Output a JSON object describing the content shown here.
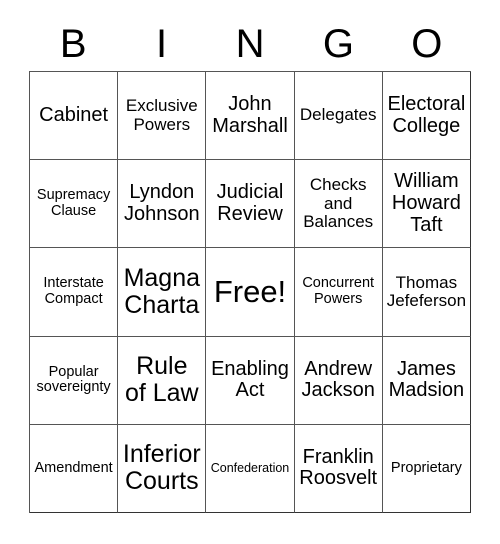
{
  "header": {
    "letters": [
      "B",
      "I",
      "N",
      "G",
      "O"
    ]
  },
  "grid": {
    "columns": 5,
    "rows": 5,
    "cells": [
      {
        "text": "Cabinet",
        "size": "l"
      },
      {
        "text": "Exclusive\nPowers",
        "size": "m"
      },
      {
        "text": "John\nMarshall",
        "size": "l"
      },
      {
        "text": "Delegates",
        "size": "m"
      },
      {
        "text": "Electoral\nCollege",
        "size": "l"
      },
      {
        "text": "Supremacy\nClause",
        "size": "s"
      },
      {
        "text": "Lyndon\nJohnson",
        "size": "l"
      },
      {
        "text": "Judicial\nReview",
        "size": "l"
      },
      {
        "text": "Checks\nand\nBalances",
        "size": "m"
      },
      {
        "text": "William\nHoward\nTaft",
        "size": "l"
      },
      {
        "text": "Interstate\nCompact",
        "size": "s"
      },
      {
        "text": "Magna\nCharta",
        "size": "xl"
      },
      {
        "text": "Free!",
        "size": "xxl"
      },
      {
        "text": "Concurrent\nPowers",
        "size": "s"
      },
      {
        "text": "Thomas\nJefeferson",
        "size": "m"
      },
      {
        "text": "Popular\nsovereignty",
        "size": "s"
      },
      {
        "text": "Rule\nof Law",
        "size": "xl"
      },
      {
        "text": "Enabling\nAct",
        "size": "l"
      },
      {
        "text": "Andrew\nJackson",
        "size": "l"
      },
      {
        "text": "James\nMadsion",
        "size": "l"
      },
      {
        "text": "Amendment",
        "size": "s"
      },
      {
        "text": "Inferior\nCourts",
        "size": "xl"
      },
      {
        "text": "Confederation",
        "size": "xs"
      },
      {
        "text": "Franklin\nRoosvelt",
        "size": "l"
      },
      {
        "text": "Proprietary",
        "size": "s"
      }
    ]
  },
  "colors": {
    "background": "#ffffff",
    "text": "#000000",
    "grid_line": "#555555",
    "outer_border": "#333333"
  }
}
